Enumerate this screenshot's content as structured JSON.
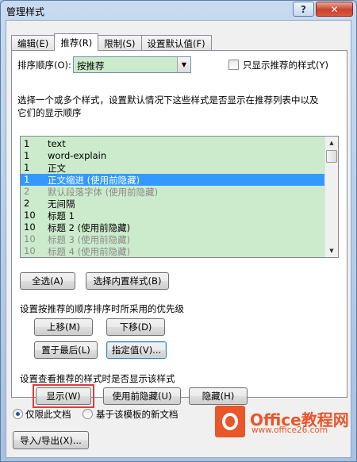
{
  "window": {
    "title": "管理样式",
    "help_label": "?",
    "close_label": "✕"
  },
  "tabs": [
    {
      "label": "编辑(E)",
      "active": false
    },
    {
      "label": "推荐(R)",
      "active": true
    },
    {
      "label": "限制(S)",
      "active": false
    },
    {
      "label": "设置默认值(F)",
      "active": false
    }
  ],
  "sort": {
    "label": "排序顺序(O):",
    "value": "按推荐",
    "arrow": "▼"
  },
  "only_recommended": {
    "label": "只显示推荐的样式(Y)",
    "checked": false
  },
  "instructions": {
    "line1": "选择一个或多个样式，设置默认情况下这些样式是否显示在推荐列表中以及",
    "line2": "它们的显示顺序"
  },
  "style_list": {
    "rows": [
      {
        "num": "1",
        "name": "text",
        "state": "normal"
      },
      {
        "num": "1",
        "name": "word-explain",
        "state": "normal"
      },
      {
        "num": "1",
        "name": "正文",
        "state": "normal"
      },
      {
        "num": "1",
        "name": "正文缩进 (使用前隐藏)",
        "state": "selected"
      },
      {
        "num": "2",
        "name": "默认段落字体 (使用前隐藏)",
        "state": "gray"
      },
      {
        "num": "2",
        "name": "无间隔",
        "state": "normal"
      },
      {
        "num": "10",
        "name": "标题 1",
        "state": "normal"
      },
      {
        "num": "10",
        "name": "标题 2 (使用前隐藏)",
        "state": "normal"
      },
      {
        "num": "10",
        "name": "标题 3 (使用前隐藏)",
        "state": "gray"
      },
      {
        "num": "10",
        "name": "标题 4 (使用前隐藏)",
        "state": "gray"
      }
    ],
    "scroll_up": "▲",
    "scroll_down": "▼"
  },
  "buttons": {
    "select_all": "全选(A)",
    "select_builtin": "选择内置样式(B)"
  },
  "priority": {
    "label": "设置按推荐的顺序排序时所采用的优先级",
    "move_up": "上移(M)",
    "move_down": "下移(D)",
    "move_last": "置于最后(L)",
    "assign_value": "指定值(V)..."
  },
  "visibility": {
    "label": "设置查看推荐的样式时是否显示该样式",
    "show": "显示(W)",
    "hide_until_used": "使用前隐藏(U)",
    "hide": "隐藏(H)"
  },
  "scope": {
    "this_doc": "仅限此文档",
    "template": "基于该模板的新文档",
    "selected": "this_doc"
  },
  "import_export": "导入/导出(X)...",
  "watermark": {
    "title": "Office教程网",
    "url": "www.office26.com"
  }
}
